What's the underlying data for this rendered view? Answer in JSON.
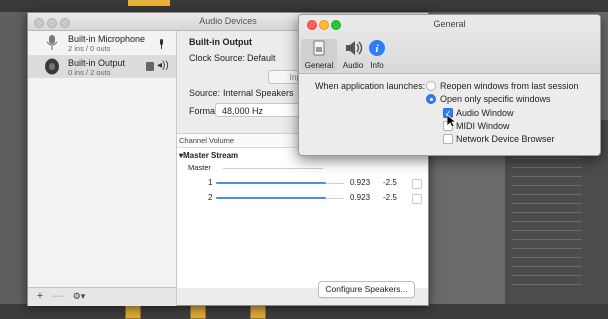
{
  "audio_devices": {
    "title": "Audio Devices",
    "devices": [
      {
        "name": "Built-in Microphone",
        "io": "2 ins / 0 outs",
        "icon": "microphone-icon"
      },
      {
        "name": "Built-in Output",
        "io": "0 ins / 2 outs",
        "icon": "speaker-icon",
        "selected": true
      }
    ],
    "footer": {
      "add": "+",
      "remove": "—",
      "action": "⚙▾"
    },
    "detail": {
      "device_title": "Built-in Output",
      "clock_label": "Clock Source:",
      "clock_value": "Default",
      "tab_input": "Input",
      "source_label": "Source:",
      "source_value": "Internal Speakers",
      "format_label": "Format:",
      "format_value": "48,000 Hz",
      "format_stepper": "⌃",
      "format_extra": "2 c",
      "table_header": "Channel Volume",
      "stream_label": "Master Stream",
      "channels": [
        {
          "name": "Master",
          "value": "",
          "db": ""
        },
        {
          "name": "1",
          "value": "0.923",
          "db": "-2.5"
        },
        {
          "name": "2",
          "value": "0.923",
          "db": "-2.5"
        }
      ],
      "configure_button": "Configure Speakers..."
    }
  },
  "general": {
    "title": "General",
    "toolbar": [
      {
        "label": "General",
        "icon": "general-switch-icon",
        "selected": true
      },
      {
        "label": "Audio",
        "icon": "audio-speaker-icon"
      },
      {
        "label": "Info",
        "icon": "info-icon"
      }
    ],
    "launch_label": "When application launches:",
    "radios": [
      {
        "label": "Reopen windows from last session",
        "selected": false
      },
      {
        "label": "Open only specific windows",
        "selected": true
      }
    ],
    "checkboxes": [
      {
        "label": "Audio Window",
        "checked": true
      },
      {
        "label": "MIDI Window",
        "checked": false
      },
      {
        "label": "Network Device Browser",
        "checked": false
      }
    ]
  },
  "colors": {
    "accent": "#2f7cf6",
    "close": "#ff5f57",
    "minimize": "#febc2e",
    "zoom": "#28c840"
  }
}
